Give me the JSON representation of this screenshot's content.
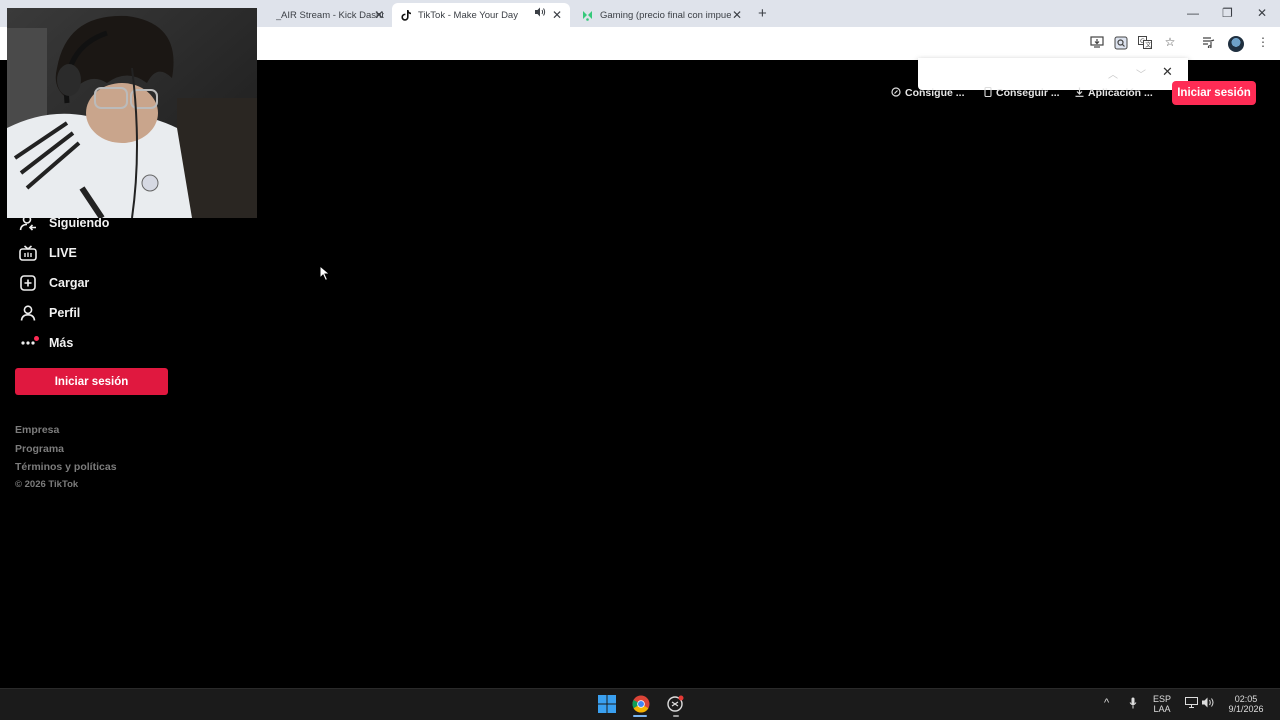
{
  "browser": {
    "tabs": [
      {
        "title": "_AIR Stream - Kick Dashb",
        "favicon": "kick-icon",
        "active": false
      },
      {
        "title": "TikTok - Make Your Day",
        "favicon": "tiktok-icon",
        "active": true,
        "audio": true
      },
      {
        "title": "Gaming (precio final con impue",
        "favicon": "shop-icon",
        "active": false
      }
    ],
    "new_tab_symbol": "+",
    "close_symbol": "✕"
  },
  "tiktok": {
    "top_actions": [
      {
        "label": "Consigue ...",
        "icon": "coin-icon"
      },
      {
        "label": "Conseguir ...",
        "icon": "device-icon"
      },
      {
        "label": "Aplicación ...",
        "icon": "download-icon"
      }
    ],
    "login_top": "Iniciar sesión",
    "nav": [
      {
        "label": "Siguiendo",
        "icon": "following-icon"
      },
      {
        "label": "LIVE",
        "icon": "live-icon"
      },
      {
        "label": "Cargar",
        "icon": "upload-icon"
      },
      {
        "label": "Perfil",
        "icon": "profile-icon"
      },
      {
        "label": "Más",
        "icon": "more-icon"
      }
    ],
    "login_side": "Iniciar sesión",
    "footer": [
      "Empresa",
      "Programa",
      "Términos y políticas"
    ],
    "copyright": "© 2026 TikTok"
  },
  "taskbar": {
    "lang_top": "ESP",
    "lang_bottom": "LAA",
    "time": "02:05",
    "date": "9/1/2026"
  },
  "colors": {
    "accent": "#fe2c55",
    "side_button": "#e0183f",
    "background": "#000000"
  }
}
